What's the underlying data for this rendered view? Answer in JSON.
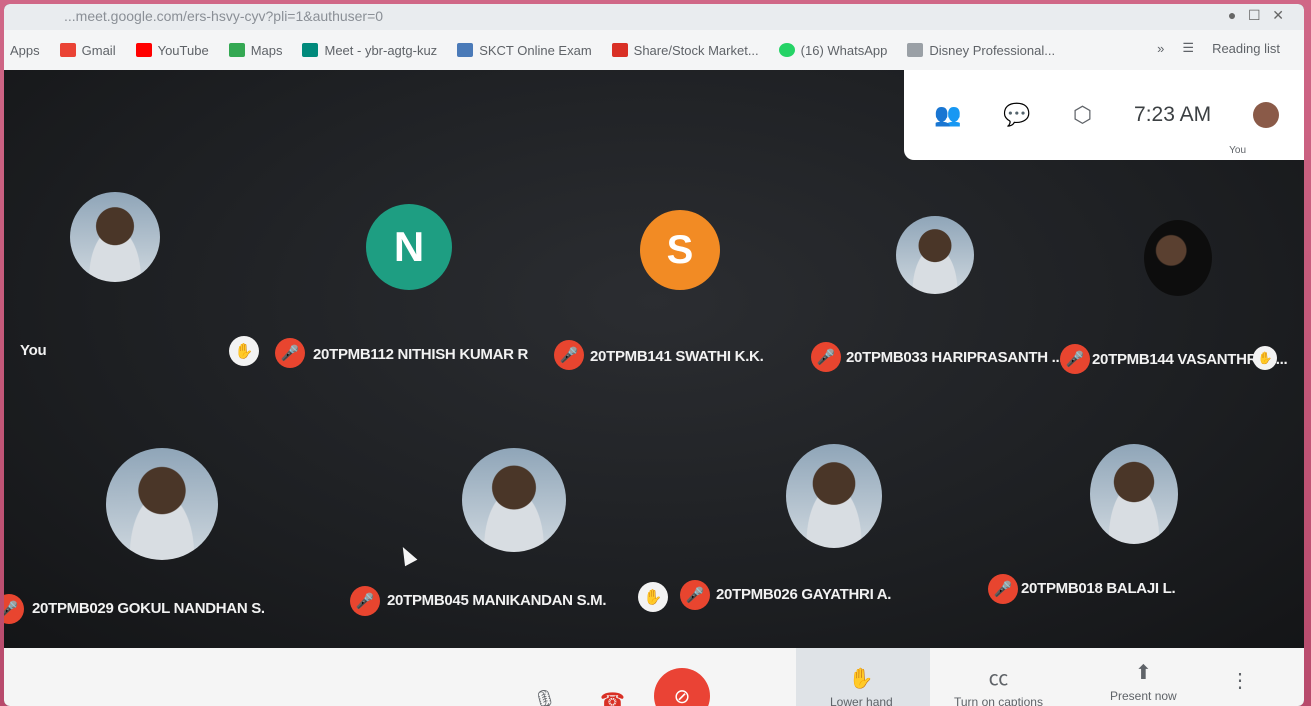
{
  "browser": {
    "url_fragment": "...meet.google.com/ers-hsvy-cyv?pli=1&authuser=0",
    "bookmarks": [
      "Apps",
      "Gmail",
      "YouTube",
      "Maps",
      "Meet - ybr-agtg-kuz",
      "SKCT Online Exam",
      "Share/Stock Market...",
      "(16) WhatsApp",
      "Disney Professional..."
    ],
    "reading_list": "Reading list"
  },
  "panel": {
    "time": "7:23 AM",
    "you_label": "You"
  },
  "participants": [
    {
      "label": "You",
      "initial": "",
      "color": ""
    },
    {
      "label": "20TPMB112 NITHISH KUMAR R",
      "initial": "N",
      "color": "#1e9e82"
    },
    {
      "label": "20TPMB141 SWATHI K.K.",
      "initial": "S",
      "color": "#f28b24"
    },
    {
      "label": "20TPMB033 HARIPRASANTH ...",
      "initial": "",
      "color": ""
    },
    {
      "label": "20TPMB144 VASANTHRAJ...",
      "initial": "",
      "color": ""
    },
    {
      "label": "20TPMB029 GOKUL NANDHAN S.",
      "initial": "",
      "color": ""
    },
    {
      "label": "20TPMB045 MANIKANDAN S.M.",
      "initial": "",
      "color": ""
    },
    {
      "label": "20TPMB026 GAYATHRI A.",
      "initial": "",
      "color": ""
    },
    {
      "label": "20TPMB018 BALAJI L.",
      "initial": "",
      "color": ""
    }
  ],
  "controls": {
    "lower_hand": "Lower hand",
    "captions": "Turn on captions",
    "present": "Present now"
  },
  "icons": [
    "gmail-icon",
    "youtube-icon",
    "maps-icon",
    "meet-icon",
    "people-icon",
    "chat-icon",
    "activities-icon",
    "mic-off-icon",
    "hand-icon",
    "end-call-icon",
    "captions-icon",
    "present-icon",
    "more-icon"
  ]
}
